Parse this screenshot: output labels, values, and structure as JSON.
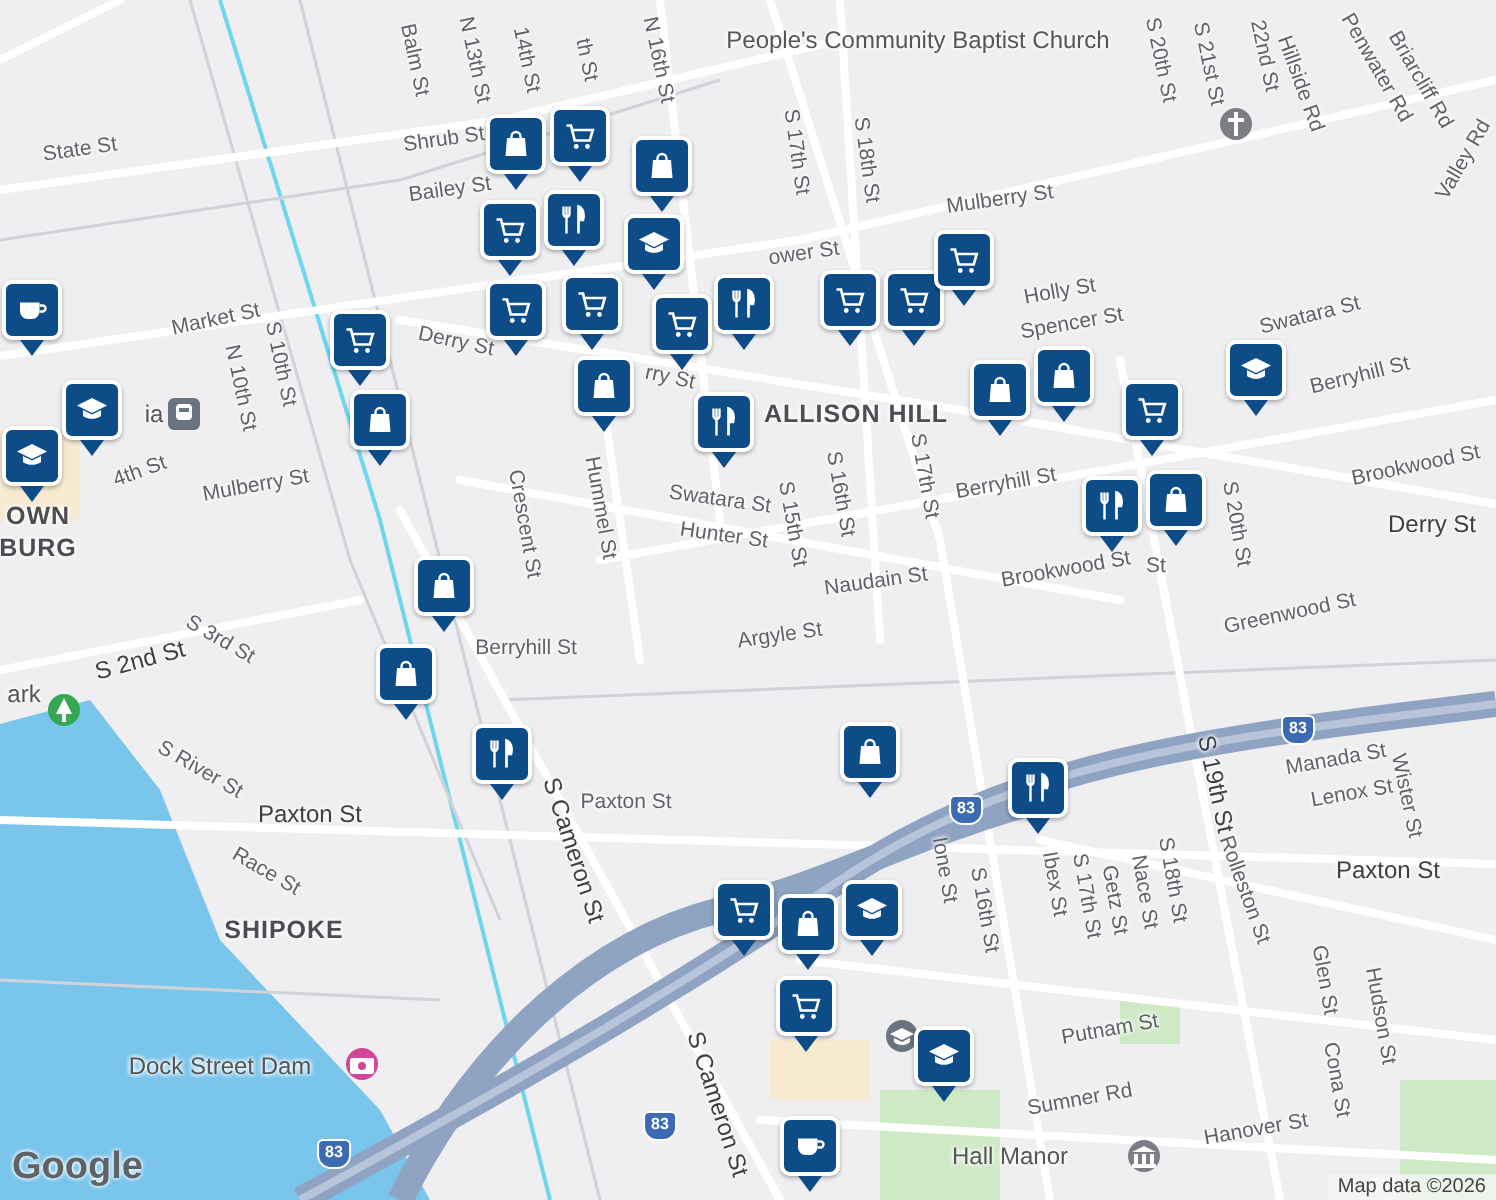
{
  "map": {
    "highway_shields": [
      {
        "text": "83"
      },
      {
        "text": "83"
      },
      {
        "text": "83"
      },
      {
        "text": "83"
      }
    ],
    "labels": [
      {
        "text": "State St",
        "kind": "street"
      },
      {
        "text": "Market St",
        "kind": "street"
      },
      {
        "text": "Derry St",
        "kind": "street"
      },
      {
        "text": "rry St",
        "kind": "street"
      },
      {
        "text": "Mulberry St",
        "kind": "street"
      },
      {
        "text": "N 10th St",
        "kind": "street"
      },
      {
        "text": "S 10th St",
        "kind": "street"
      },
      {
        "text": "Balm St",
        "kind": "street"
      },
      {
        "text": "N 13th St",
        "kind": "street"
      },
      {
        "text": "14th St",
        "kind": "street"
      },
      {
        "text": "th St",
        "kind": "street"
      },
      {
        "text": "N 16th St",
        "kind": "street"
      },
      {
        "text": "Shrub St",
        "kind": "street"
      },
      {
        "text": "Bailey St",
        "kind": "street"
      },
      {
        "text": "S 17th St",
        "kind": "street"
      },
      {
        "text": "S 18th St",
        "kind": "street"
      },
      {
        "text": "People's Community Baptist Church",
        "kind": "poi"
      },
      {
        "text": "Mulberry St",
        "kind": "street"
      },
      {
        "text": "ower St",
        "kind": "street"
      },
      {
        "text": "Holly St",
        "kind": "street"
      },
      {
        "text": "Spencer St",
        "kind": "street"
      },
      {
        "text": "Swatara St",
        "kind": "street"
      },
      {
        "text": "Berryhill St",
        "kind": "street"
      },
      {
        "text": "ALLISON HILL",
        "kind": "area"
      },
      {
        "text": "S 20th St",
        "kind": "street"
      },
      {
        "text": "S 21st St",
        "kind": "street"
      },
      {
        "text": "22nd St",
        "kind": "street"
      },
      {
        "text": "Hillside Rd",
        "kind": "street"
      },
      {
        "text": "Penwater Rd",
        "kind": "street"
      },
      {
        "text": "Briarcliff Rd",
        "kind": "street"
      },
      {
        "text": "Valley Rd",
        "kind": "street"
      },
      {
        "text": "Crescent St",
        "kind": "street"
      },
      {
        "text": "Hummel St",
        "kind": "street"
      },
      {
        "text": "Swatara St",
        "kind": "street"
      },
      {
        "text": "Hunter St",
        "kind": "street"
      },
      {
        "text": "S 15th St",
        "kind": "street"
      },
      {
        "text": "S 16th St",
        "kind": "street"
      },
      {
        "text": "S 17th St",
        "kind": "street"
      },
      {
        "text": "Berryhill St",
        "kind": "street"
      },
      {
        "text": "Naudain St",
        "kind": "street"
      },
      {
        "text": "Argyle St",
        "kind": "street"
      },
      {
        "text": "Berryhill St",
        "kind": "street"
      },
      {
        "text": "Brookwood St",
        "kind": "street"
      },
      {
        "text": "Greenwood St",
        "kind": "street"
      },
      {
        "text": "Brookwood St",
        "kind": "street"
      },
      {
        "text": "Derry St",
        "kind": "street-major"
      },
      {
        "text": "S 20th St",
        "kind": "street"
      },
      {
        "text": "St",
        "kind": "street"
      },
      {
        "text": "S 19th St",
        "kind": "street-major"
      },
      {
        "text": "Manada St",
        "kind": "street"
      },
      {
        "text": "Lenox St",
        "kind": "street"
      },
      {
        "text": "Wister St",
        "kind": "street"
      },
      {
        "text": "Paxton St",
        "kind": "street-major"
      },
      {
        "text": "Paxton St",
        "kind": "street-major"
      },
      {
        "text": "Paxton St",
        "kind": "street"
      },
      {
        "text": "S Cameron St",
        "kind": "street-major"
      },
      {
        "text": "S Cameron St",
        "kind": "street-major"
      },
      {
        "text": "S 2nd St",
        "kind": "street-major"
      },
      {
        "text": "S 3rd St",
        "kind": "street"
      },
      {
        "text": "S River St",
        "kind": "street"
      },
      {
        "text": "Race St",
        "kind": "street"
      },
      {
        "text": "SHIPOKE",
        "kind": "area"
      },
      {
        "text": "OWN",
        "kind": "area"
      },
      {
        "text": "BURG",
        "kind": "area"
      },
      {
        "text": "ark",
        "kind": "poi"
      },
      {
        "text": "ia",
        "kind": "poi"
      },
      {
        "text": "4th St",
        "kind": "street"
      },
      {
        "text": "Dock Street Dam",
        "kind": "poi"
      },
      {
        "text": "Hall Manor",
        "kind": "poi"
      },
      {
        "text": "Hanover St",
        "kind": "street"
      },
      {
        "text": "Sumner Rd",
        "kind": "street"
      },
      {
        "text": "Putnam St",
        "kind": "street"
      },
      {
        "text": "Rolleston St",
        "kind": "street"
      },
      {
        "text": "Glen St",
        "kind": "street"
      },
      {
        "text": "Hudson St",
        "kind": "street"
      },
      {
        "text": "Cona St",
        "kind": "street"
      },
      {
        "text": "Ione St",
        "kind": "street"
      },
      {
        "text": "S 16th St",
        "kind": "street"
      },
      {
        "text": "Ibex St",
        "kind": "street"
      },
      {
        "text": "S 17th St",
        "kind": "street"
      },
      {
        "text": "Getz St",
        "kind": "street"
      },
      {
        "text": "Nace St",
        "kind": "street"
      },
      {
        "text": "S 18th St",
        "kind": "street"
      }
    ],
    "markers": [
      {
        "kind": "bag"
      },
      {
        "kind": "cart"
      },
      {
        "kind": "bag"
      },
      {
        "kind": "school"
      },
      {
        "kind": "cart"
      },
      {
        "kind": "restaurant"
      },
      {
        "kind": "cart"
      },
      {
        "kind": "cart"
      },
      {
        "kind": "cart"
      },
      {
        "kind": "restaurant"
      },
      {
        "kind": "cart"
      },
      {
        "kind": "cart"
      },
      {
        "kind": "cart"
      },
      {
        "kind": "bag"
      },
      {
        "kind": "bag"
      },
      {
        "kind": "cart"
      },
      {
        "kind": "school"
      },
      {
        "kind": "bag"
      },
      {
        "kind": "restaurant"
      },
      {
        "kind": "cart"
      },
      {
        "kind": "bag"
      },
      {
        "kind": "bag"
      },
      {
        "kind": "restaurant"
      },
      {
        "kind": "cafe"
      },
      {
        "kind": "school"
      },
      {
        "kind": "school"
      },
      {
        "kind": "bag"
      },
      {
        "kind": "bag"
      },
      {
        "kind": "restaurant"
      },
      {
        "kind": "bag"
      },
      {
        "kind": "restaurant"
      },
      {
        "kind": "cart"
      },
      {
        "kind": "bag"
      },
      {
        "kind": "school"
      },
      {
        "kind": "cart"
      },
      {
        "kind": "school"
      },
      {
        "kind": "cafe"
      }
    ],
    "places": [
      {
        "kind": "church"
      },
      {
        "kind": "transit"
      },
      {
        "kind": "park"
      },
      {
        "kind": "attraction"
      },
      {
        "kind": "museum"
      },
      {
        "kind": "school"
      }
    ],
    "attribution": {
      "logo": "Google",
      "text": "Map data ©2026"
    }
  }
}
